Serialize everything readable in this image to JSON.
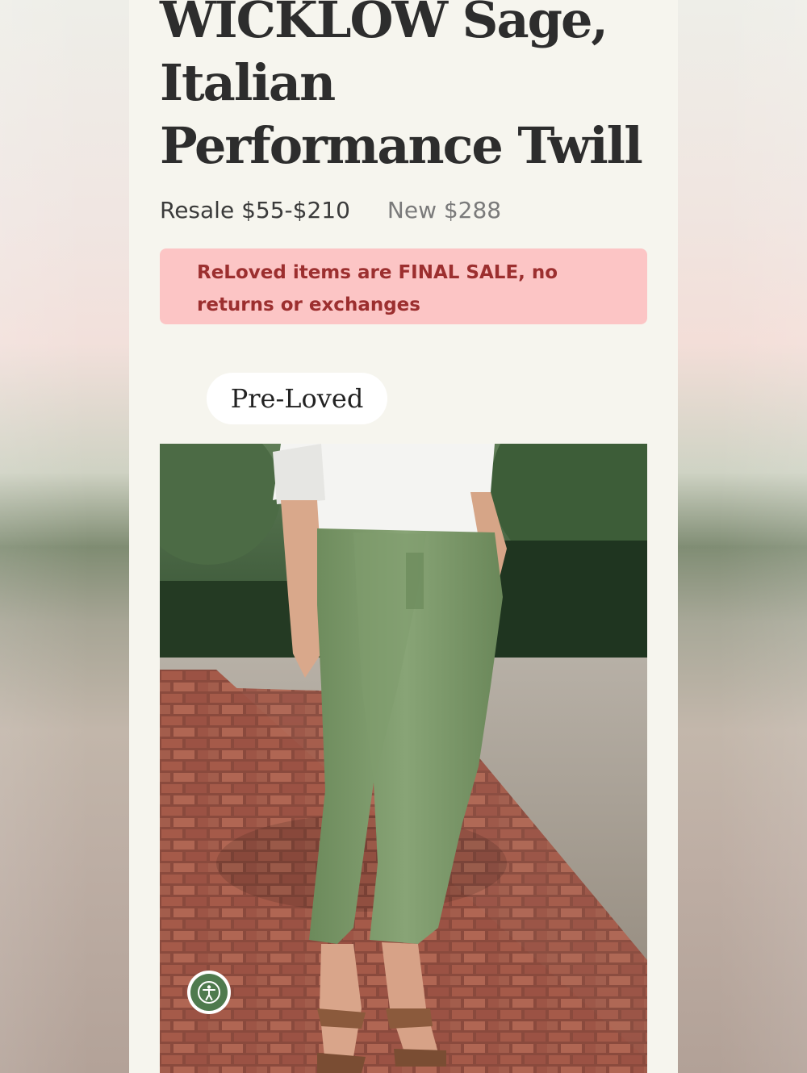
{
  "product": {
    "title": "WICKLOW Sage, Italian Performance Twill",
    "resale_price": "Resale $55-$210",
    "new_price": "New $288",
    "notice": "ReLoved items are FINAL SALE, no returns or exchanges",
    "condition_tag": "Pre-Loved",
    "image_description_icon": "product-photo"
  },
  "accessibility": {
    "icon": "accessibility-icon",
    "color": "#4f7a4e"
  },
  "colors": {
    "page_background": "#f6f5ee",
    "notice_background": "#fcc5c5",
    "notice_text": "#9c2f2f",
    "title_text": "#2d2d2d"
  }
}
